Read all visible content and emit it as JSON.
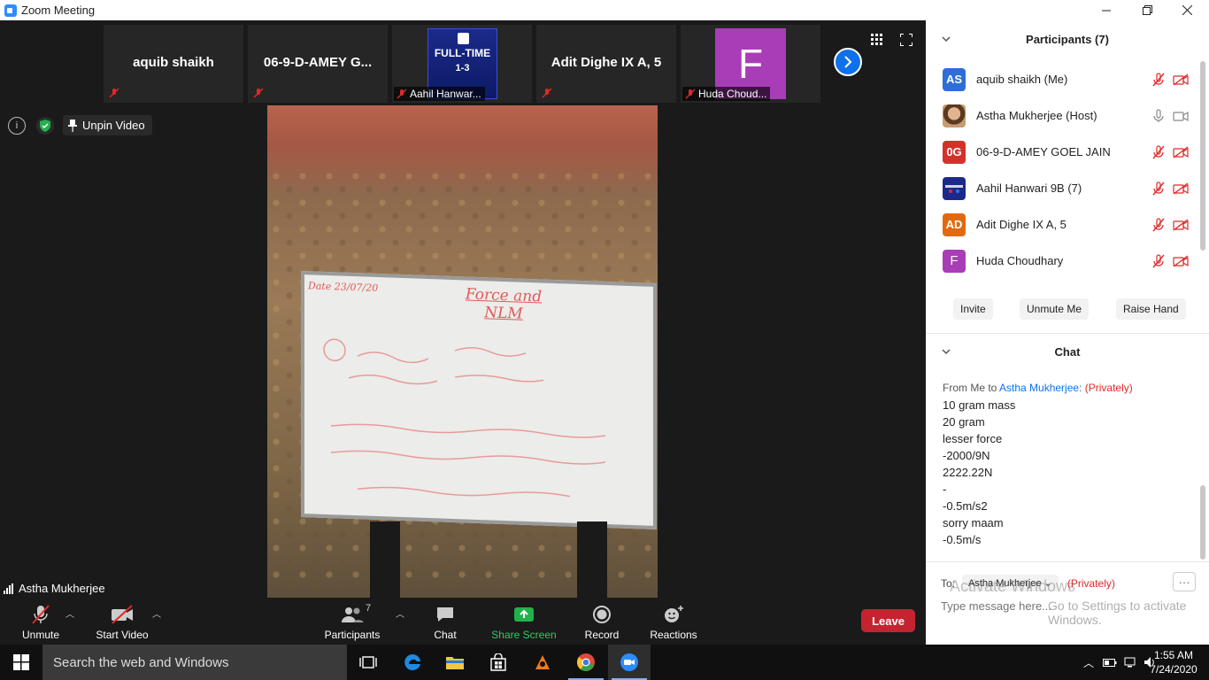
{
  "window": {
    "title": "Zoom Meeting"
  },
  "thumbnails": [
    {
      "name": "aquib shaikh"
    },
    {
      "name": "06-9-D-AMEY G..."
    },
    {
      "name": "Aahil Hanwar...",
      "image_text_top": "FULL-TIME",
      "image_text_score": "1-3"
    },
    {
      "name": "Adit Dighe IX A, 5"
    },
    {
      "name": "Huda Choud...",
      "avatar_letter": "F"
    }
  ],
  "video": {
    "unpin_label": "Unpin Video",
    "speaker_name": "Astha Mukherjee"
  },
  "toolbar": {
    "unmute": "Unmute",
    "start_video": "Start Video",
    "participants": "Participants",
    "participants_count": "7",
    "chat": "Chat",
    "share_screen": "Share Screen",
    "record": "Record",
    "reactions": "Reactions",
    "leave": "Leave"
  },
  "participants_panel": {
    "title": "Participants (7)",
    "list": [
      {
        "initials": "AS",
        "name": "aquib shaikh (Me)",
        "color": "#2d6fd6",
        "muted": true
      },
      {
        "initials": "",
        "name": "Astha Mukherjee (Host)",
        "color": "#b07a5a",
        "muted": false
      },
      {
        "initials": "0G",
        "name": "06-9-D-AMEY GOEL JAIN",
        "color": "#d4312b",
        "muted": true
      },
      {
        "initials": "",
        "name": "Aahil Hanwari 9B (7)",
        "color": "#1b2a8a",
        "muted": true
      },
      {
        "initials": "AD",
        "name": "Adit Dighe IX A, 5",
        "color": "#e06a10",
        "muted": true
      },
      {
        "initials": "F",
        "name": "Huda Choudhary",
        "color": "#a93db8",
        "muted": true
      }
    ],
    "invite": "Invite",
    "unmute_me": "Unmute Me",
    "raise_hand": "Raise Hand"
  },
  "chat_panel": {
    "title": "Chat",
    "from_prefix": "From Me to",
    "to_name": "Astha Mukherjee:",
    "privately": "(Privately)",
    "messages": [
      "10 gram mass",
      "20 gram",
      "lesser force",
      "-2000/9N",
      "2222.22N",
      "-",
      "-0.5m/s2",
      "sorry maam",
      "-0.5m/s"
    ],
    "to_label": "To:",
    "to_recipient": "Astha Mukherjee",
    "to_privately": "(Privately)",
    "input_placeholder": "Type message here...",
    "watermark_title": "Activate Windows",
    "watermark_sub": "Go to Settings to activate Windows."
  },
  "taskbar": {
    "search_placeholder": "Search the web and Windows",
    "time": "1:55 AM",
    "date": "7/24/2020"
  },
  "whiteboard": {
    "date": "Date 23/07/20",
    "heading": "Force and NLM"
  }
}
